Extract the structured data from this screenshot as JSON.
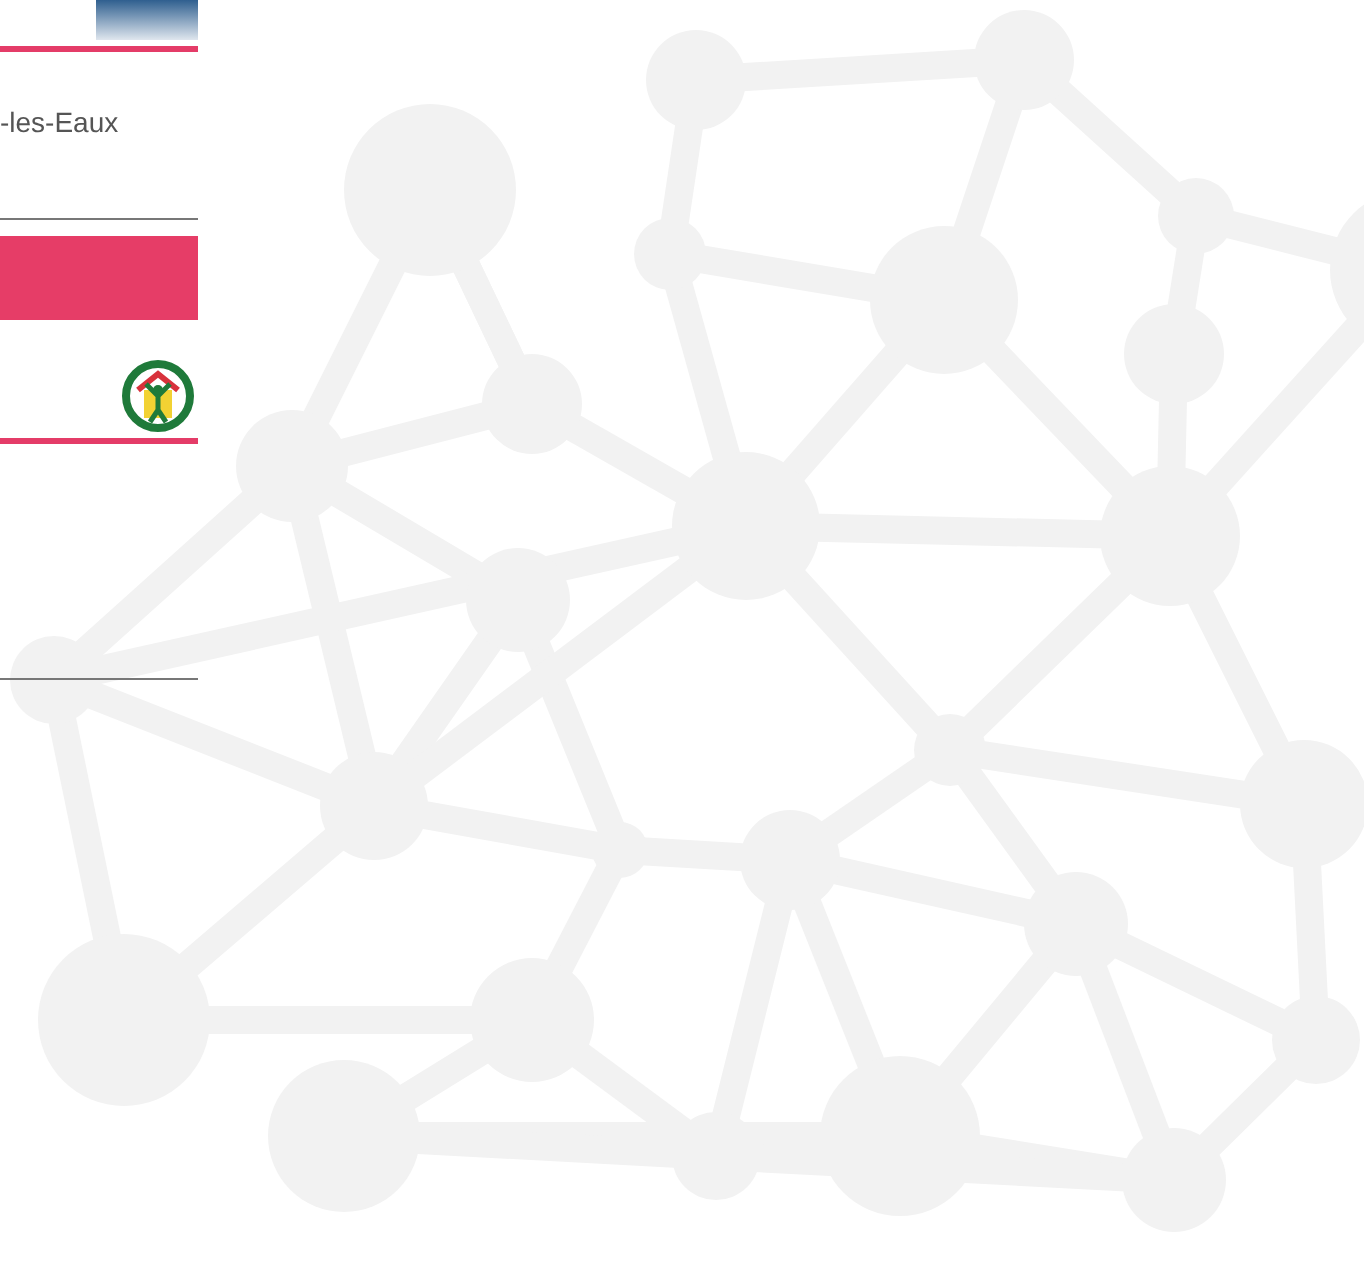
{
  "location_text": "-les-Eaux"
}
